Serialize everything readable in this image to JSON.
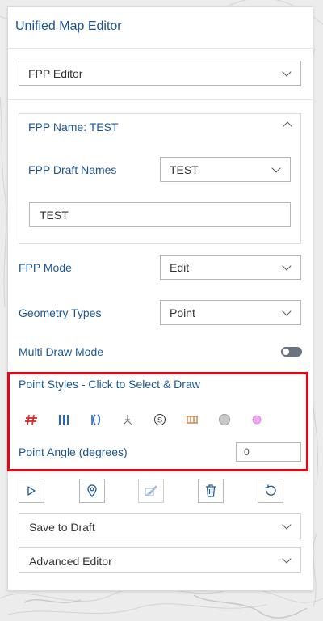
{
  "panel": {
    "title": "Unified Map Editor"
  },
  "editor_select": {
    "value": "FPP Editor"
  },
  "fpp_card": {
    "title": "FPP Name: TEST",
    "draft_names_label": "FPP Draft Names",
    "draft_names_value": "TEST",
    "name_input_value": "TEST"
  },
  "mode": {
    "label": "FPP Mode",
    "value": "Edit"
  },
  "geometry": {
    "label": "Geometry Types",
    "value": "Point"
  },
  "multi_draw": {
    "label": "Multi Draw Mode",
    "enabled": false
  },
  "point_styles": {
    "label": "Point Styles - Click to Select & Draw",
    "icons": [
      {
        "name": "hash-red-icon",
        "color": "#d92b2b"
      },
      {
        "name": "triple-bar-blue-icon",
        "color": "#2563c9"
      },
      {
        "name": "paren-blue-icon",
        "color": "#2563c9"
      },
      {
        "name": "tripod-gray-icon",
        "color": "#777777"
      },
      {
        "name": "s-circle-icon",
        "color": "#333333"
      },
      {
        "name": "ladder-orange-icon",
        "color": "#c77d3a"
      },
      {
        "name": "gray-circle-icon",
        "color": "#c8c8c8"
      },
      {
        "name": "pink-circle-icon",
        "color": "#f0a8f0"
      }
    ]
  },
  "angle": {
    "label": "Point Angle (degrees)",
    "value": "0"
  },
  "toolbar": {
    "tools": [
      "select-tool-icon",
      "marker-tool-icon",
      "edit-tool-icon",
      "delete-icon",
      "undo-icon"
    ]
  },
  "accordions": {
    "save_to_draft": "Save to Draft",
    "advanced_editor": "Advanced Editor"
  },
  "colors": {
    "accent": "#1a5694",
    "highlight": "#e30613"
  }
}
